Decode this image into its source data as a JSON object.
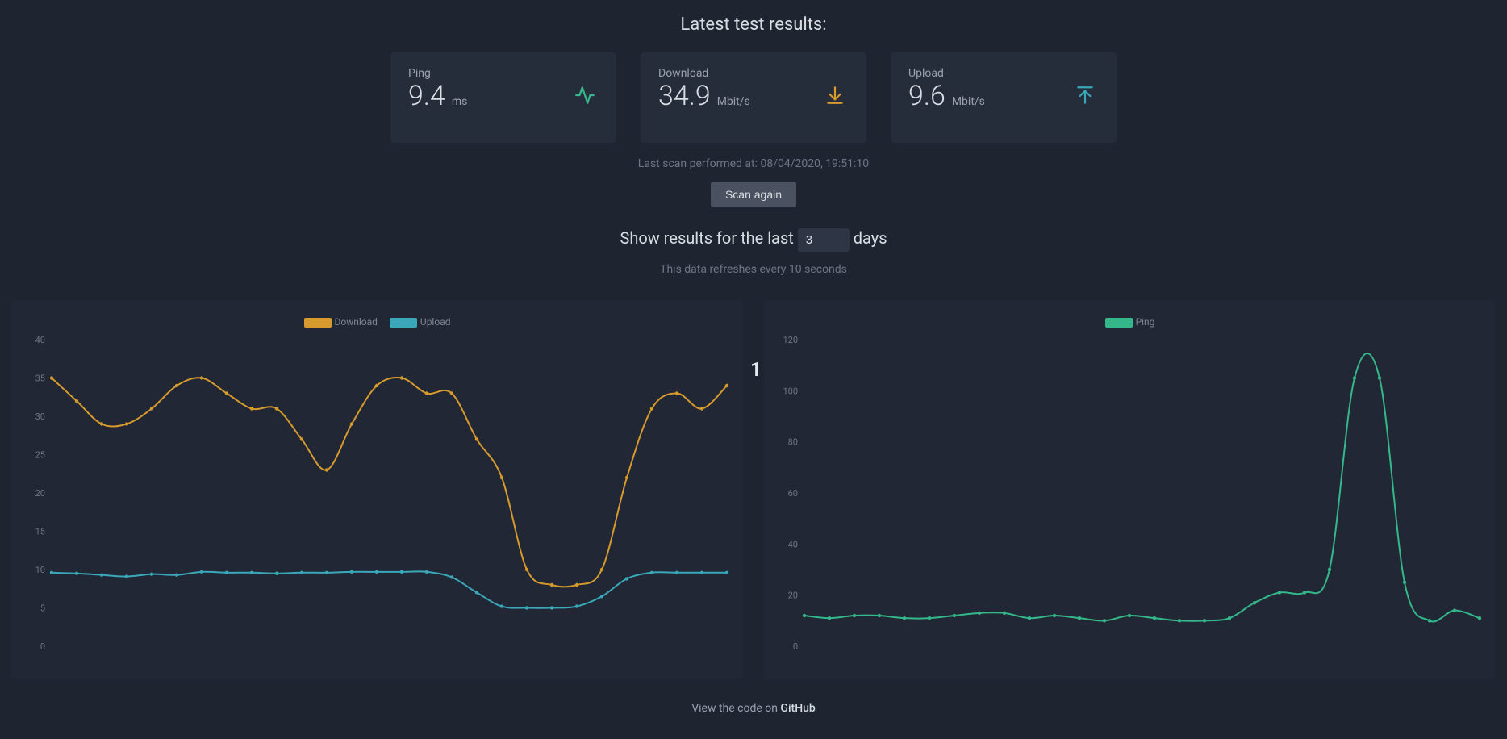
{
  "title": "Latest test results:",
  "cards": {
    "ping": {
      "label": "Ping",
      "value": "9.4",
      "unit": "ms"
    },
    "download": {
      "label": "Download",
      "value": "34.9",
      "unit": "Mbit/s"
    },
    "upload": {
      "label": "Upload",
      "value": "9.6",
      "unit": "Mbit/s"
    }
  },
  "last_scan": "Last scan performed at: 08/04/2020, 19:51:10",
  "scan_button": "Scan again",
  "days_row": {
    "prefix": "Show results for the last",
    "value": "3",
    "suffix": "days"
  },
  "refresh_note": "This data refreshes every 10 seconds",
  "floating": "1",
  "footer": {
    "prefix": "View the code on ",
    "link": "GitHub"
  },
  "colors": {
    "download": "#d69a2d",
    "upload": "#3aa8b8",
    "ping": "#34b88a"
  },
  "chart_data": [
    {
      "type": "line",
      "title": "",
      "xlabel": "",
      "ylabel": "",
      "ylim": [
        0,
        40
      ],
      "yticks": [
        0,
        5,
        10,
        15,
        20,
        25,
        30,
        35,
        40
      ],
      "x": [
        0,
        1,
        2,
        3,
        4,
        5,
        6,
        7,
        8,
        9,
        10,
        11,
        12,
        13,
        14,
        15,
        16,
        17,
        18,
        19,
        20,
        21,
        22,
        23,
        24,
        25,
        26,
        27
      ],
      "series": [
        {
          "name": "Download",
          "color": "#d69a2d",
          "values": [
            35,
            32,
            29,
            29,
            31,
            34,
            35,
            33,
            31,
            31,
            27,
            23,
            29,
            34,
            35,
            33,
            33,
            27,
            22,
            10,
            8,
            8,
            10,
            22,
            31,
            33,
            31,
            34
          ]
        },
        {
          "name": "Upload",
          "color": "#3aa8b8",
          "values": [
            9.6,
            9.5,
            9.3,
            9.1,
            9.4,
            9.3,
            9.7,
            9.6,
            9.6,
            9.5,
            9.6,
            9.6,
            9.7,
            9.7,
            9.7,
            9.7,
            9.0,
            7.0,
            5.2,
            5.0,
            5.0,
            5.2,
            6.5,
            8.8,
            9.6,
            9.6,
            9.6,
            9.6
          ]
        }
      ]
    },
    {
      "type": "line",
      "title": "",
      "xlabel": "",
      "ylabel": "",
      "ylim": [
        0,
        120
      ],
      "yticks": [
        0,
        20,
        40,
        60,
        80,
        100,
        120
      ],
      "x": [
        0,
        1,
        2,
        3,
        4,
        5,
        6,
        7,
        8,
        9,
        10,
        11,
        12,
        13,
        14,
        15,
        16,
        17,
        18,
        19,
        20,
        21,
        22,
        23,
        24,
        25,
        26,
        27
      ],
      "series": [
        {
          "name": "Ping",
          "color": "#34b88a",
          "values": [
            12,
            11,
            12,
            12,
            11,
            11,
            12,
            13,
            13,
            11,
            12,
            11,
            10,
            12,
            11,
            10,
            10,
            11,
            17,
            21,
            21,
            30,
            105,
            105,
            25,
            10,
            14,
            11
          ]
        }
      ]
    }
  ]
}
